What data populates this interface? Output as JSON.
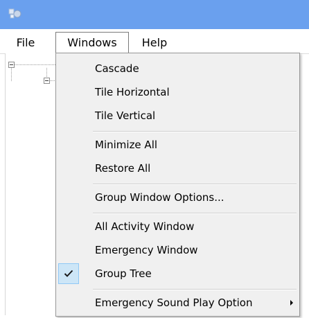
{
  "titlebar": {
    "icon": "app-window-icon",
    "color": "#6aa0ee"
  },
  "menubar": {
    "items": [
      {
        "label": "File"
      },
      {
        "label": "Windows"
      },
      {
        "label": "Help"
      }
    ]
  },
  "windows_menu": {
    "items": [
      {
        "label": "Cascade"
      },
      {
        "label": "Tile Horizontal"
      },
      {
        "label": "Tile Vertical"
      },
      {
        "label": "Minimize All"
      },
      {
        "label": "Restore All"
      },
      {
        "label": "Group Window Options..."
      },
      {
        "label": "All Activity Window"
      },
      {
        "label": "Emergency Window"
      },
      {
        "label": "Group Tree",
        "checked": true
      },
      {
        "label": "Emergency Sound Play Option",
        "has_submenu": true
      }
    ],
    "check_highlight_color": "#cde6f7"
  }
}
